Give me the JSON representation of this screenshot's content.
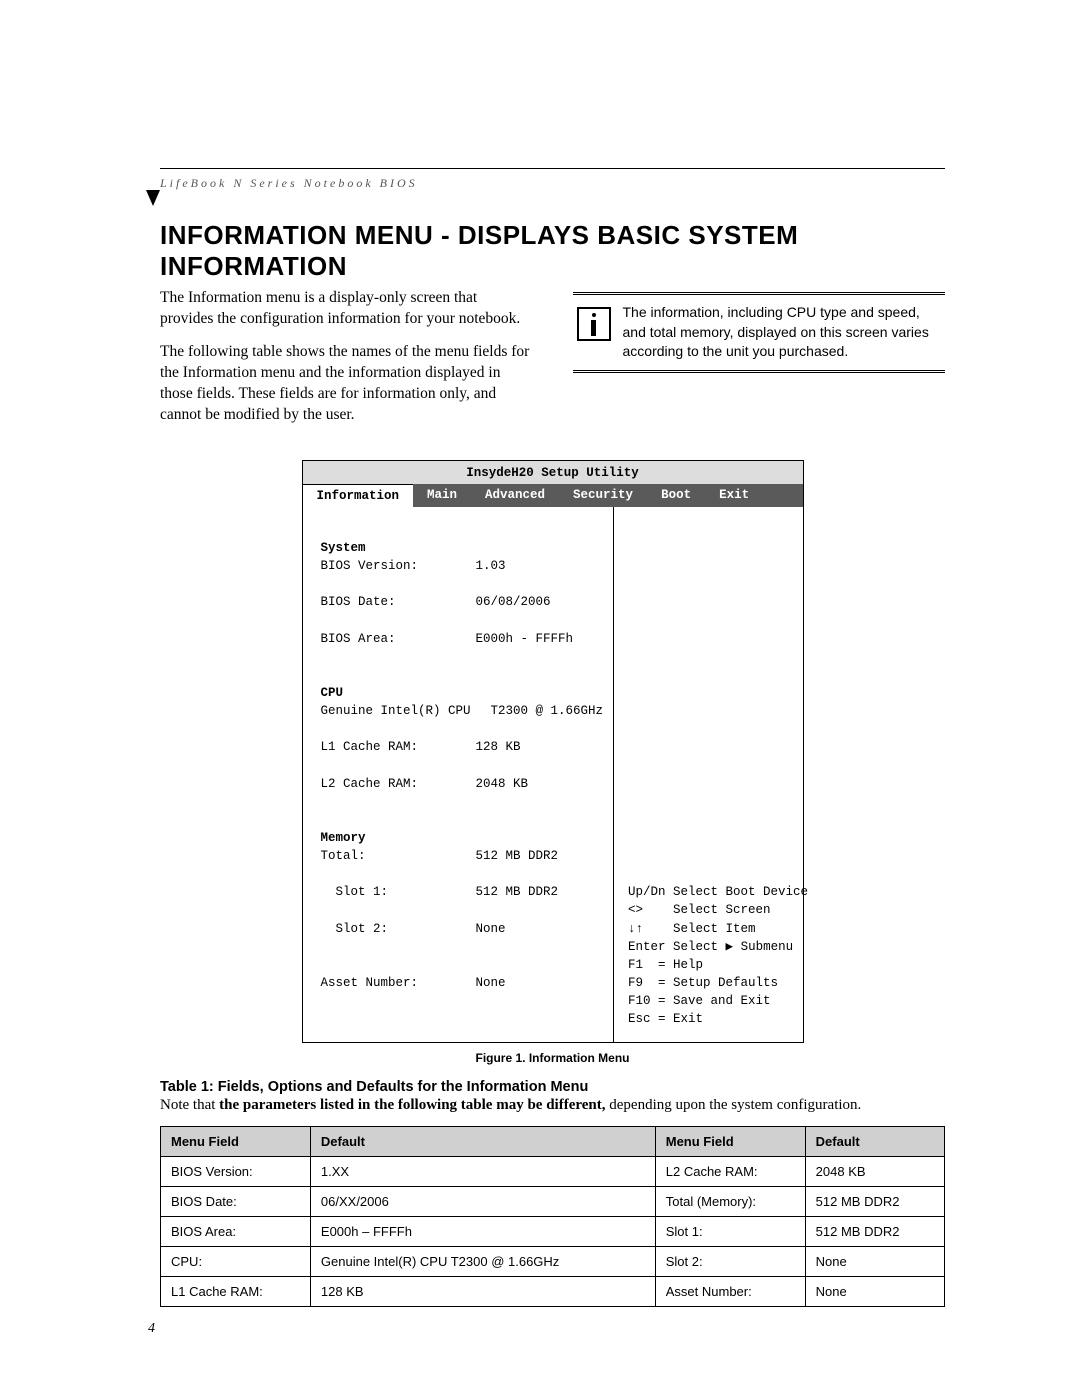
{
  "running_head": "LifeBook N Series Notebook BIOS",
  "title": "INFORMATION MENU - DISPLAYS BASIC SYSTEM INFORMATION",
  "intro": {
    "p1": "The Information menu is a display-only screen that provides the configuration information for your notebook.",
    "p2": "The following table shows the names of the menu fields for the Information menu and the information displayed in those fields. These fields are for information only, and cannot be modified by the user."
  },
  "info_note": "The information, including CPU type and speed, and total memory, displayed on this screen varies according to the unit you purchased.",
  "bios": {
    "utility_title": "InsydeH20 Setup Utility",
    "tabs": [
      "Information",
      "Main",
      "Advanced",
      "Security",
      "Boot",
      "Exit"
    ],
    "active_tab": "Information",
    "sections": {
      "system": {
        "heading": "System",
        "rows": [
          {
            "label": "BIOS Version:",
            "value": "1.03"
          },
          {
            "label": "BIOS Date:",
            "value": "06/08/2006"
          },
          {
            "label": "BIOS Area:",
            "value": "E000h - FFFFh"
          }
        ]
      },
      "cpu": {
        "heading": "CPU",
        "rows": [
          {
            "label": "Genuine Intel(R) CPU",
            "value": "T2300 @ 1.66GHz"
          },
          {
            "label": "L1 Cache RAM:",
            "value": "128 KB"
          },
          {
            "label": "L2 Cache RAM:",
            "value": "2048 KB"
          }
        ]
      },
      "memory": {
        "heading": "Memory",
        "rows": [
          {
            "label": "Total:",
            "value": "512 MB DDR2"
          },
          {
            "label": "  Slot 1:",
            "value": "512 MB DDR2"
          },
          {
            "label": "  Slot 2:",
            "value": "None"
          }
        ]
      },
      "asset": {
        "label": "Asset Number:",
        "value": "None"
      }
    },
    "help": [
      "Up/Dn Select Boot Device",
      "<>    Select Screen",
      "↓↑    Select Item",
      "Enter Select ▶ Submenu",
      "F1  = Help",
      "F9  = Setup Defaults",
      "F10 = Save and Exit",
      "Esc = Exit"
    ]
  },
  "figure_caption": "Figure 1.  Information Menu",
  "table_title": "Table 1: Fields, Options and Defaults for the Information Menu",
  "table_note_prefix": "Note that ",
  "table_note_bold": "the parameters listed in the following table may be different,",
  "table_note_suffix": " depending upon the system configuration.",
  "table": {
    "headers": [
      "Menu Field",
      "Default",
      "Menu Field",
      "Default"
    ],
    "rows": [
      [
        "BIOS Version:",
        "1.XX",
        "L2 Cache RAM:",
        "2048 KB"
      ],
      [
        "BIOS Date:",
        "06/XX/2006",
        "Total (Memory):",
        "512 MB DDR2"
      ],
      [
        "BIOS Area:",
        "E000h – FFFFh",
        "Slot 1:",
        "512 MB DDR2"
      ],
      [
        "CPU:",
        "Genuine Intel(R) CPU T2300 @ 1.66GHz",
        "Slot 2:",
        "None"
      ],
      [
        "L1 Cache RAM:",
        "128 KB",
        "Asset Number:",
        "None"
      ]
    ]
  },
  "page_number": "4"
}
